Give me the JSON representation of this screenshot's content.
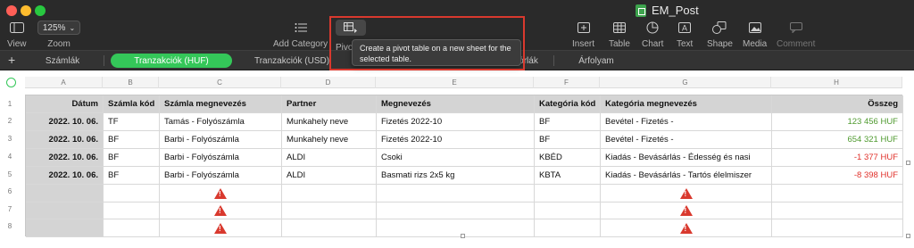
{
  "window": {
    "title": "EM_Post"
  },
  "toolbar": {
    "view_label": "View",
    "zoom_value": "125%",
    "zoom_label": "Zoom",
    "add_category_label": "Add Category",
    "pivot_label": "Pivot",
    "insert_label": "Insert",
    "table_label": "Table",
    "chart_label": "Chart",
    "text_label": "Text",
    "shape_label": "Shape",
    "media_label": "Media",
    "comment_label": "Comment"
  },
  "tooltip": {
    "text": "Create a pivot table on a new sheet for the selected table."
  },
  "tabs": [
    {
      "label": "Számlák"
    },
    {
      "label": "Tranzakciók (HUF)"
    },
    {
      "label": "Tranzakciók (USD)"
    },
    {
      "label": "órlák"
    },
    {
      "label": "Árfolyam"
    }
  ],
  "columns": [
    "A",
    "B",
    "C",
    "D",
    "E",
    "F",
    "G",
    "H"
  ],
  "row_numbers": [
    "1",
    "2",
    "3",
    "4",
    "5",
    "6",
    "7",
    "8"
  ],
  "table": {
    "headers": [
      "Dátum",
      "Számla kód",
      "Számla megnevezés",
      "Partner",
      "Megnevezés",
      "Kategória kód",
      "Kategória megnevezés",
      "Összeg"
    ],
    "rows": [
      [
        "2022. 10. 06.",
        "TF",
        "Tamás - Folyószámla",
        "Munkahely neve",
        "Fizetés 2022-10",
        "BF",
        "Bevétel - Fizetés -",
        "123 456 HUF"
      ],
      [
        "2022. 10. 06.",
        "BF",
        "Barbi - Folyószámla",
        "Munkahely neve",
        "Fizetés 2022-10",
        "BF",
        "Bevétel - Fizetés -",
        "654 321 HUF"
      ],
      [
        "2022. 10. 06.",
        "BF",
        "Barbi - Folyószámla",
        "ALDI",
        "Csoki",
        "KBÉD",
        "Kiadás - Bevásárlás - Édesség és nasi",
        "-1 377 HUF"
      ],
      [
        "2022. 10. 06.",
        "BF",
        "Barbi - Folyószámla",
        "ALDI",
        "Basmati rizs 2x5 kg",
        "KBTA",
        "Kiadás - Bevásárlás - Tartós élelmiszer",
        "-8 398 HUF"
      ]
    ]
  },
  "colors": {
    "accent": "#34c759",
    "positive": "#4f9a2f",
    "negative": "#e0302a",
    "warning": "#d9392e"
  }
}
